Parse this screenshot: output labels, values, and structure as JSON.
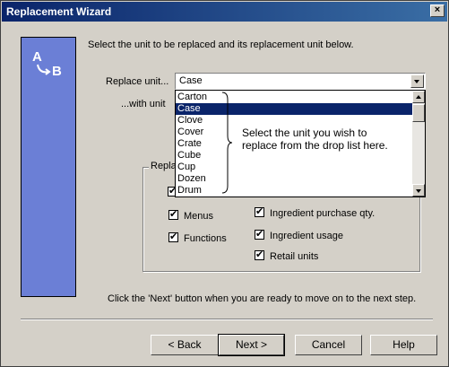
{
  "window": {
    "title": "Replacement Wizard",
    "close_label": "x"
  },
  "logo": {
    "text_a": "A",
    "text_b": "B",
    "color": "#6b7fd6"
  },
  "instruction": "Select the unit to be replaced and its replacement unit below.",
  "replace_unit": {
    "label": "Replace unit...",
    "value": "Case"
  },
  "with_unit": {
    "label": "...with unit"
  },
  "dropdown": {
    "options": [
      "Carton",
      "Case",
      "Clove",
      "Cover",
      "Crate",
      "Cube",
      "Cup",
      "Dozen",
      "Drum"
    ],
    "selected": "Case"
  },
  "tooltip": "Select the unit you wish to replace from the drop list here.",
  "groupbox": {
    "label": "Repla"
  },
  "checks": {
    "menus": "Menus",
    "functions": "Functions",
    "ingredient_purchase": "Ingredient purchase qty.",
    "ingredient_usage": "Ingredient usage",
    "retail_units": "Retail units"
  },
  "footer_note": "Click the 'Next' button when you are ready to move on to the next step.",
  "buttons": {
    "back": "< Back",
    "next": "Next >",
    "cancel": "Cancel",
    "help": "Help"
  }
}
